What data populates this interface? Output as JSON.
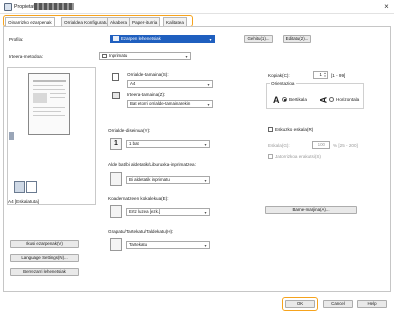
{
  "window": {
    "title": "Propietateak",
    "close_glyph": "×"
  },
  "tabs": [
    {
      "label": "Oinarrizko ezarpenak"
    },
    {
      "label": "Orrialdea Konfiguratu"
    },
    {
      "label": "Akabera"
    },
    {
      "label": "Paper-iturria"
    },
    {
      "label": "Kalitatea"
    }
  ],
  "profile": {
    "label": "Profila:",
    "value": "Ezarpen lehenetsiak",
    "edit_label": "Gehitu(1)...",
    "edit2_label": "Editatu(2)..."
  },
  "output": {
    "label": "Irteera-metodoa:",
    "value": "Inprimatu"
  },
  "preview": {
    "caption": "A4 [Eskalatuta]"
  },
  "left_buttons": {
    "restore": "Ikusi ezarpenak(V)",
    "language": "Language Settings(N)...",
    "defaults": "Berrezarri lehenetsiak"
  },
  "page_size": {
    "label": "Orrialde-tamaina(S):",
    "value": "A4"
  },
  "output_size": {
    "label": "Irteera-tamaina(Z):",
    "value": "Bat etorri orrialde-tamainarekin"
  },
  "copies": {
    "label": "Kopiak(C):",
    "value": "1",
    "range": "[1 - 99]"
  },
  "orientation": {
    "label": "Orientazioa",
    "vertical": "Bertikala",
    "horizontal": "Horizontala",
    "vertical_glyph": "A",
    "horizontal_glyph": "A"
  },
  "page_layout": {
    "label": "Orrialde-diseinua(Y):",
    "value": "1 bat",
    "icon_num": "1"
  },
  "manual_scale": {
    "label": "Eskuzko eskala(R)",
    "scale_label": "Eskala(G):",
    "scale_value": "100",
    "scale_range": "% [25 - 200]",
    "watermark": "Jatorrizkoa erakutsi(S)"
  },
  "duplex": {
    "label": "Alde bat/bi aldetatik/Liburuxka-inprimatzea:",
    "value": "Bi aldetatik inprimatu"
  },
  "binding": {
    "label": "Koadernatzeen kokalekua(E):",
    "value": "Ertz luzea [ezk.]",
    "margin_btn": "Barne-marjina(A)..."
  },
  "staple": {
    "label": "Grapatu/Tartekatu/Taldekatu(H):",
    "value": "Tartekatu"
  },
  "footer": {
    "ok": "OK",
    "cancel": "Cancel",
    "help": "Help"
  },
  "colors": {
    "highlight": "#f6a31d",
    "selected": "#1f5fbf"
  }
}
